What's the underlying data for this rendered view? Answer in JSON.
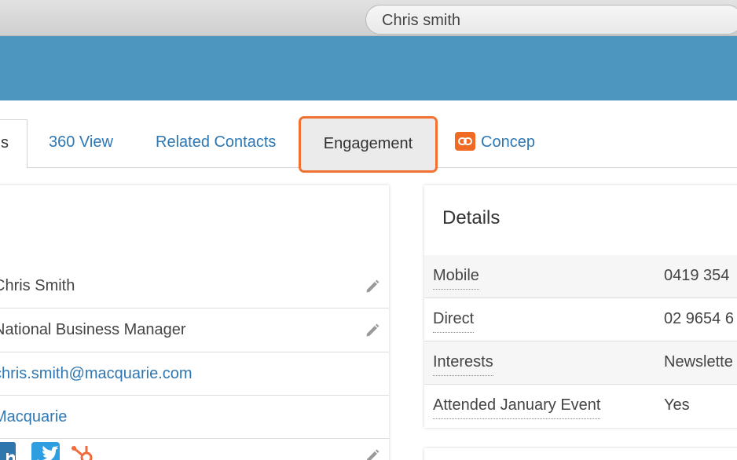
{
  "search": {
    "value": "Chris smith"
  },
  "tabs": [
    {
      "label": "s"
    },
    {
      "label": "360 View"
    },
    {
      "label": "Related Contacts"
    },
    {
      "label": "Engagement"
    },
    {
      "label": "Concep"
    }
  ],
  "profile": {
    "name": "Chris Smith",
    "title": "National Business Manager",
    "email": "chris.smith@macquarie.com",
    "company": "Macquarie"
  },
  "details": {
    "title": "Details",
    "rows": [
      {
        "label": "Mobile",
        "value": "0419 354"
      },
      {
        "label": "Direct",
        "value": "02 9654 6"
      },
      {
        "label": "Interests",
        "value": "Newslette"
      },
      {
        "label": "Attended January Event",
        "value": "Yes"
      }
    ]
  },
  "colors": {
    "banner": "#4c96c0",
    "link": "#2e77b3",
    "highlight": "#f07131",
    "concep_brand": "#ef6b24"
  },
  "icons": [
    "pencil-icon",
    "linkedin-icon",
    "twitter-icon",
    "hubspot-icon",
    "concep-icon"
  ]
}
